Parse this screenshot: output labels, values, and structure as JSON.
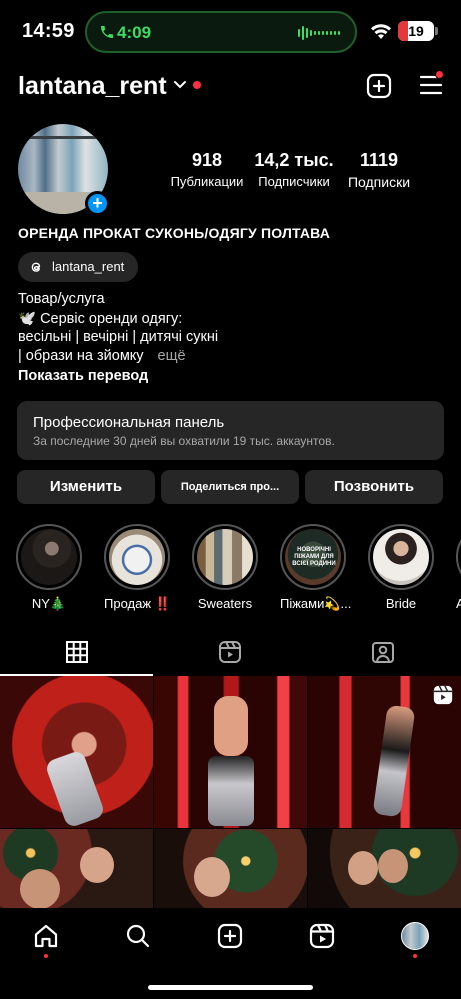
{
  "status_bar": {
    "time": "14:59",
    "call_time": "4:09",
    "battery": "19"
  },
  "header": {
    "username": "lantana_rent"
  },
  "profile": {
    "stats": [
      {
        "value": "918",
        "label": "Публикации"
      },
      {
        "value": "14,2 тыс.",
        "label": "Подписчики"
      },
      {
        "value": "1119",
        "label": "Подписки"
      }
    ],
    "name": "ОРЕНДА ПРОКАТ СУКОНЬ/ОДЯГУ ПОЛТАВА",
    "threads_label": "lantana_rent",
    "bio_lines": [
      "Товар/услуга",
      "🕊️ Сервіс оренди одягу:",
      "весільні | вечірні | дитячі сукні",
      "| образи на зйомку"
    ],
    "more_label": "ещё",
    "translate_label": "Показать перевод"
  },
  "pro_panel": {
    "title": "Профессиональная панель",
    "subtitle": "За последние 30 дней вы охватили 19 тыс. аккаунтов."
  },
  "actions": {
    "edit": "Изменить",
    "share": "Поделиться про...",
    "call": "Позвонить"
  },
  "highlights": [
    {
      "label": "NY🎄"
    },
    {
      "label": "Продаж ‼️"
    },
    {
      "label": "Sweaters"
    },
    {
      "label": "Піжами💫..."
    },
    {
      "label": "Bride"
    },
    {
      "label": "А"
    }
  ],
  "highlight_pajama_text": "НОВОРІЧНІ ПІЖАМИ ДЛЯ ВСІЄЇ РОДИНИ",
  "colors": {
    "accent": "#0095f6",
    "notification": "#ff3040",
    "surface": "#262626",
    "call_green": "#3ddc63"
  },
  "icons": {
    "tabs": [
      "grid-icon",
      "reels-icon",
      "tagged-icon"
    ],
    "nav": [
      "home-icon",
      "search-icon",
      "create-icon",
      "reels-icon",
      "profile-avatar"
    ]
  }
}
